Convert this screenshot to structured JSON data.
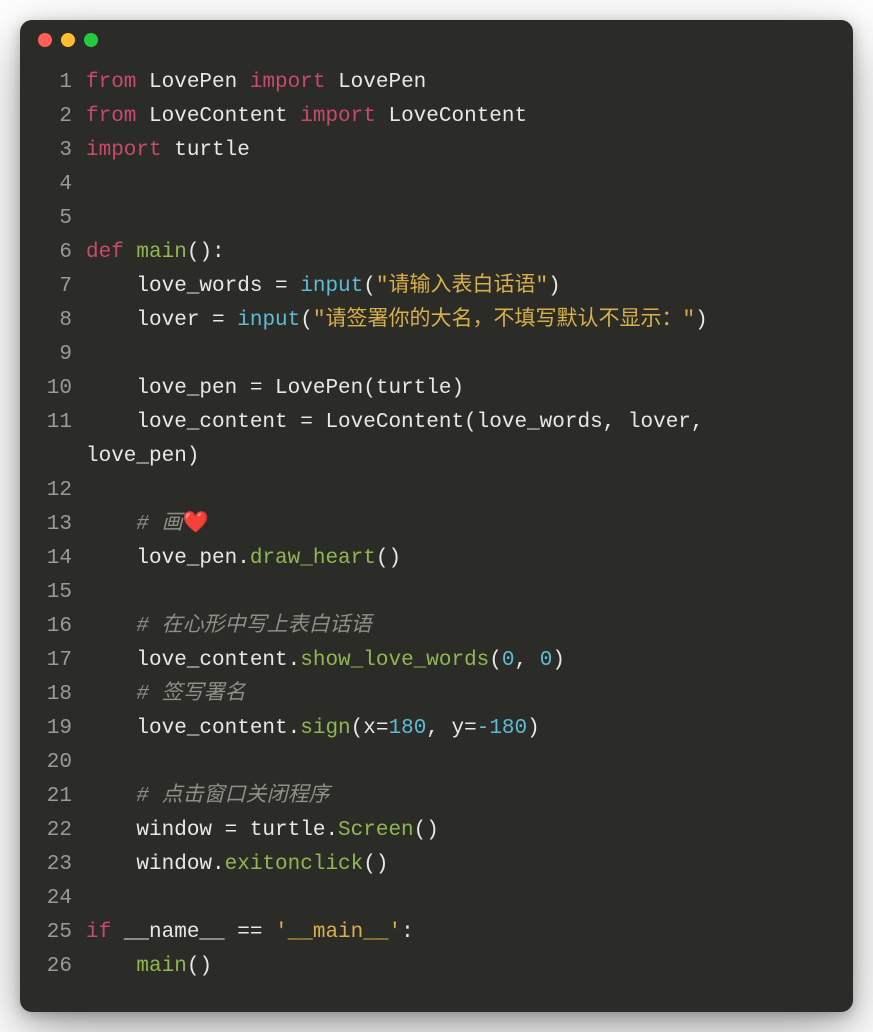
{
  "window": {
    "buttons": [
      "close",
      "minimize",
      "maximize"
    ]
  },
  "code": {
    "lines": [
      {
        "n": 1,
        "tokens": [
          [
            "kw",
            "from"
          ],
          [
            "plain",
            " LovePen "
          ],
          [
            "kw",
            "import"
          ],
          [
            "plain",
            " LovePen"
          ]
        ]
      },
      {
        "n": 2,
        "tokens": [
          [
            "kw",
            "from"
          ],
          [
            "plain",
            " LoveContent "
          ],
          [
            "kw",
            "import"
          ],
          [
            "plain",
            " LoveContent"
          ]
        ]
      },
      {
        "n": 3,
        "tokens": [
          [
            "kw",
            "import"
          ],
          [
            "plain",
            " turtle"
          ]
        ]
      },
      {
        "n": 4,
        "tokens": []
      },
      {
        "n": 5,
        "tokens": []
      },
      {
        "n": 6,
        "tokens": [
          [
            "kw",
            "def "
          ],
          [
            "fn",
            "main"
          ],
          [
            "plain",
            "():"
          ]
        ]
      },
      {
        "n": 7,
        "tokens": [
          [
            "plain",
            "    love_words = "
          ],
          [
            "bi",
            "input"
          ],
          [
            "plain",
            "("
          ],
          [
            "str",
            "\"请输入表白话语\""
          ],
          [
            "plain",
            ")"
          ]
        ]
      },
      {
        "n": 8,
        "tokens": [
          [
            "plain",
            "    lover = "
          ],
          [
            "bi",
            "input"
          ],
          [
            "plain",
            "("
          ],
          [
            "str",
            "\"请签署你的大名，不填写默认不显示：\""
          ],
          [
            "plain",
            ")"
          ]
        ]
      },
      {
        "n": 9,
        "tokens": []
      },
      {
        "n": 10,
        "tokens": [
          [
            "plain",
            "    love_pen = LovePen(turtle)"
          ]
        ]
      },
      {
        "n": 11,
        "tokens": [
          [
            "plain",
            "    love_content = LoveContent(love_words, lover, "
          ]
        ],
        "wrap": [
          [
            "plain",
            "love_pen)"
          ]
        ]
      },
      {
        "n": 12,
        "tokens": []
      },
      {
        "n": 13,
        "tokens": [
          [
            "plain",
            "    "
          ],
          [
            "com",
            "# 画"
          ],
          [
            "emoji",
            "❤️"
          ]
        ]
      },
      {
        "n": 14,
        "tokens": [
          [
            "plain",
            "    love_pen."
          ],
          [
            "fn",
            "draw_heart"
          ],
          [
            "plain",
            "()"
          ]
        ]
      },
      {
        "n": 15,
        "tokens": []
      },
      {
        "n": 16,
        "tokens": [
          [
            "plain",
            "    "
          ],
          [
            "com",
            "# 在心形中写上表白话语"
          ]
        ]
      },
      {
        "n": 17,
        "tokens": [
          [
            "plain",
            "    love_content."
          ],
          [
            "fn",
            "show_love_words"
          ],
          [
            "plain",
            "("
          ],
          [
            "num",
            "0"
          ],
          [
            "plain",
            ", "
          ],
          [
            "num",
            "0"
          ],
          [
            "plain",
            ")"
          ]
        ]
      },
      {
        "n": 18,
        "tokens": [
          [
            "plain",
            "    "
          ],
          [
            "com",
            "# 签写署名"
          ]
        ]
      },
      {
        "n": 19,
        "tokens": [
          [
            "plain",
            "    love_content."
          ],
          [
            "fn",
            "sign"
          ],
          [
            "plain",
            "(x="
          ],
          [
            "num",
            "180"
          ],
          [
            "plain",
            ", y="
          ],
          [
            "num",
            "-180"
          ],
          [
            "plain",
            ")"
          ]
        ]
      },
      {
        "n": 20,
        "tokens": []
      },
      {
        "n": 21,
        "tokens": [
          [
            "plain",
            "    "
          ],
          [
            "com",
            "# 点击窗口关闭程序"
          ]
        ]
      },
      {
        "n": 22,
        "tokens": [
          [
            "plain",
            "    window = turtle."
          ],
          [
            "fn",
            "Screen"
          ],
          [
            "plain",
            "()"
          ]
        ]
      },
      {
        "n": 23,
        "tokens": [
          [
            "plain",
            "    window."
          ],
          [
            "fn",
            "exitonclick"
          ],
          [
            "plain",
            "()"
          ]
        ]
      },
      {
        "n": 24,
        "tokens": []
      },
      {
        "n": 25,
        "tokens": [
          [
            "kw",
            "if"
          ],
          [
            "plain",
            " __name__ == "
          ],
          [
            "str",
            "'__main__'"
          ],
          [
            "plain",
            ":"
          ]
        ]
      },
      {
        "n": 26,
        "tokens": [
          [
            "plain",
            "    "
          ],
          [
            "fn",
            "main"
          ],
          [
            "plain",
            "()"
          ]
        ]
      }
    ]
  }
}
